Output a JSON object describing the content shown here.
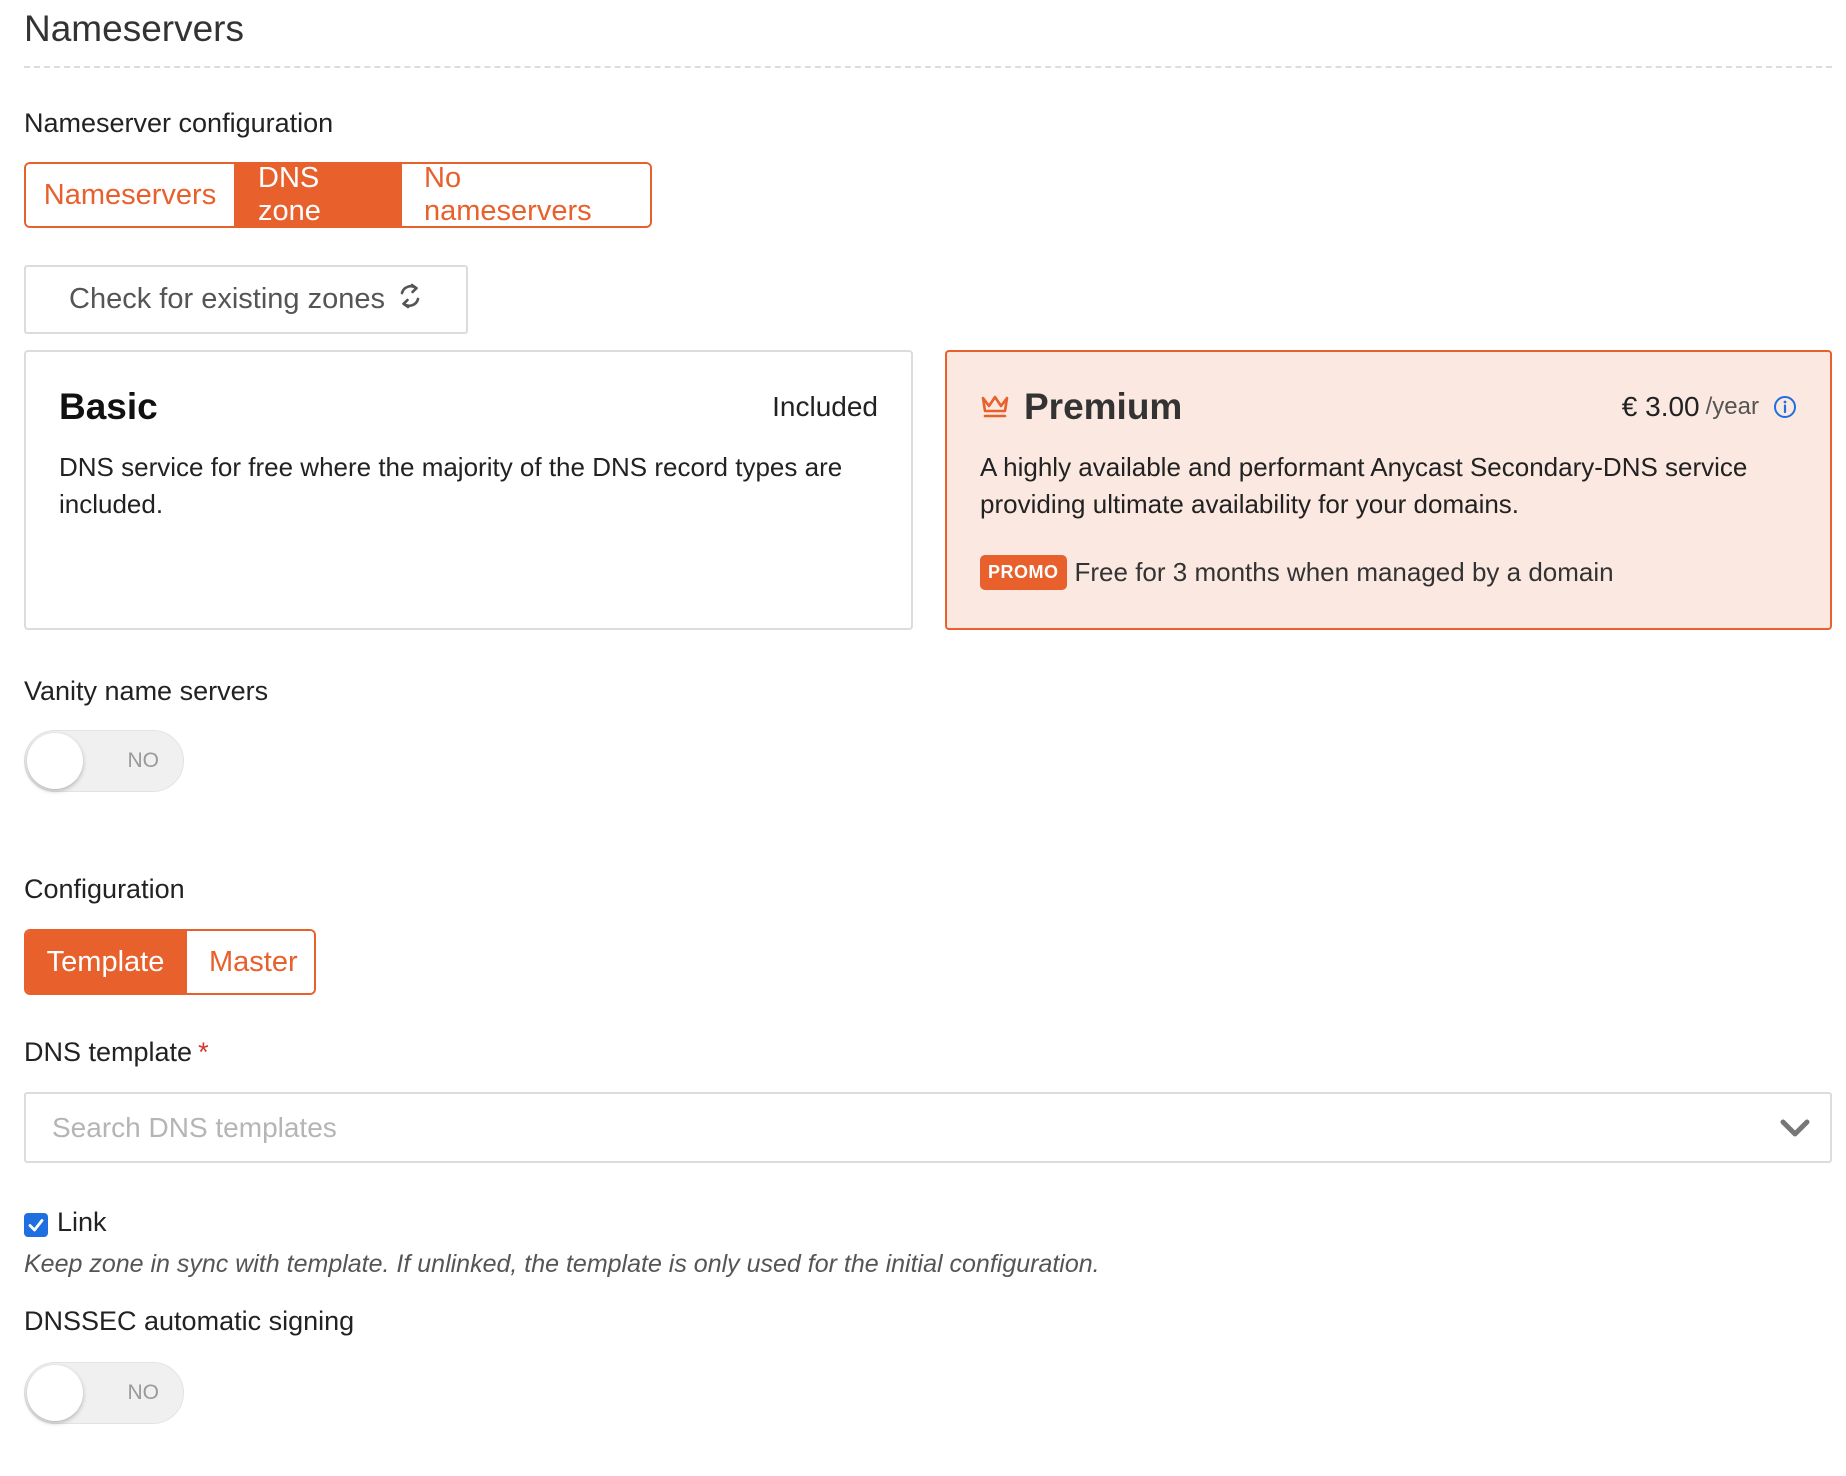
{
  "section": {
    "title": "Nameservers"
  },
  "nameserver_config": {
    "label": "Nameserver configuration",
    "options": [
      "Nameservers",
      "DNS zone",
      "No nameservers"
    ],
    "selected": "DNS zone"
  },
  "check_zones": {
    "label": "Check for existing zones",
    "icon": "refresh-icon"
  },
  "plans": {
    "basic": {
      "title": "Basic",
      "price": "Included",
      "description": "DNS service for free where the majority of the DNS record types are included."
    },
    "premium": {
      "icon": "crown-icon",
      "title": "Premium",
      "price": "€ 3.00",
      "per": "/year",
      "info_icon": "info-icon",
      "description": "A highly available and performant Anycast Secondary-DNS service providing ultimate availability for your domains.",
      "promo_badge": "PROMO",
      "promo_text": "Free for 3 months when managed by a domain",
      "selected": true
    }
  },
  "vanity": {
    "label": "Vanity name servers",
    "toggle": "NO",
    "enabled": false
  },
  "configuration": {
    "label": "Configuration",
    "options": [
      "Template",
      "Master"
    ],
    "selected": "Template"
  },
  "dns_template": {
    "label": "DNS template",
    "required_mark": "*",
    "placeholder": "Search DNS templates",
    "value": "",
    "icon": "chevron-down-icon"
  },
  "link": {
    "label": "Link",
    "checked": true,
    "hint": "Keep zone in sync with template. If unlinked, the template is only used for the initial configuration."
  },
  "dnssec": {
    "label": "DNSSEC automatic signing",
    "toggle": "NO",
    "enabled": false
  },
  "colors": {
    "accent": "#e8602c",
    "premium_bg": "#fbe8e1",
    "info": "#1f6fe0",
    "required": "#d9352b"
  }
}
